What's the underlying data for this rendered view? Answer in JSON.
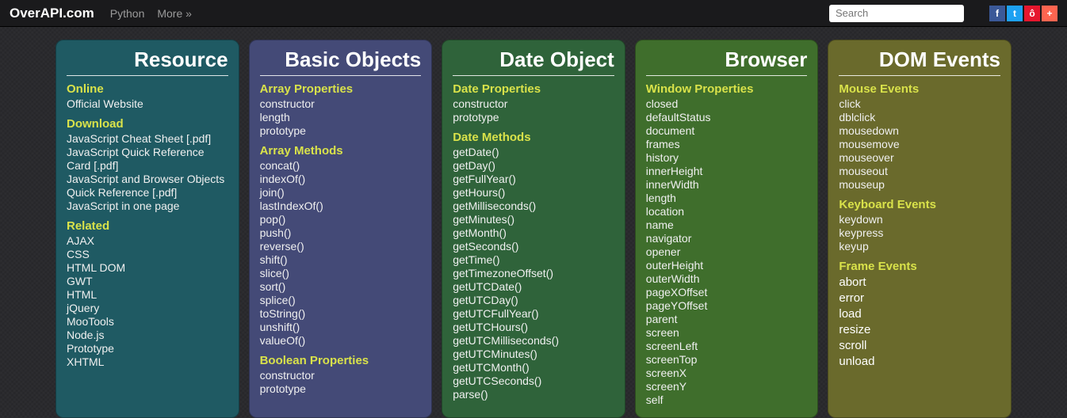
{
  "topbar": {
    "brand": "OverAPI.com",
    "links": [
      "Python",
      "More »"
    ],
    "search_placeholder": "Search",
    "social": [
      {
        "name": "facebook",
        "glyph": "f",
        "cls": "fb"
      },
      {
        "name": "twitter",
        "glyph": "t",
        "cls": "tw"
      },
      {
        "name": "weibo",
        "glyph": "ô",
        "cls": "wb"
      },
      {
        "name": "share",
        "glyph": "+",
        "cls": "pl"
      }
    ]
  },
  "columns": [
    {
      "title": "Resource",
      "cls": "c0",
      "groups": [
        {
          "heading": "Online",
          "items": [
            "Official Website"
          ]
        },
        {
          "heading": "Download",
          "items": [
            "JavaScript Cheat Sheet [.pdf]",
            "JavaScript Quick Reference Card [.pdf]",
            "JavaScript and Browser Objects Quick Reference [.pdf]",
            "JavaScript in one page"
          ]
        },
        {
          "heading": "Related",
          "items": [
            "AJAX",
            "CSS",
            "HTML DOM",
            "GWT",
            "HTML",
            "jQuery",
            "MooTools",
            "Node.js",
            "Prototype",
            "XHTML"
          ]
        }
      ]
    },
    {
      "title": "Basic Objects",
      "cls": "c1",
      "groups": [
        {
          "heading": "Array Properties",
          "items": [
            "constructor",
            "length",
            "prototype"
          ]
        },
        {
          "heading": "Array Methods",
          "items": [
            "concat()",
            "indexOf()",
            "join()",
            "lastIndexOf()",
            "pop()",
            "push()",
            "reverse()",
            "shift()",
            "slice()",
            "sort()",
            "splice()",
            "toString()",
            "unshift()",
            "valueOf()"
          ]
        },
        {
          "heading": "Boolean Properties",
          "items": [
            "constructor",
            "prototype"
          ]
        }
      ]
    },
    {
      "title": "Date Object",
      "cls": "c2",
      "groups": [
        {
          "heading": "Date Properties",
          "items": [
            "constructor",
            "prototype"
          ]
        },
        {
          "heading": "Date Methods",
          "items": [
            "getDate()",
            "getDay()",
            "getFullYear()",
            "getHours()",
            "getMilliseconds()",
            "getMinutes()",
            "getMonth()",
            "getSeconds()",
            "getTime()",
            "getTimezoneOffset()",
            "getUTCDate()",
            "getUTCDay()",
            "getUTCFullYear()",
            "getUTCHours()",
            "getUTCMilliseconds()",
            "getUTCMinutes()",
            "getUTCMonth()",
            "getUTCSeconds()",
            "parse()"
          ]
        }
      ]
    },
    {
      "title": "Browser",
      "cls": "c3",
      "groups": [
        {
          "heading": "Window Properties",
          "items": [
            "closed",
            "defaultStatus",
            "document",
            "frames",
            "history",
            "innerHeight",
            "innerWidth",
            "length",
            "location",
            "name",
            "navigator",
            "opener",
            "outerHeight",
            "outerWidth",
            "pageXOffset",
            "pageYOffset",
            "parent",
            "screen",
            "screenLeft",
            "screenTop",
            "screenX",
            "screenY",
            "self"
          ]
        }
      ]
    },
    {
      "title": "DOM Events",
      "cls": "c4",
      "groups": [
        {
          "heading": "Mouse Events",
          "items": [
            "click",
            "dblclick",
            "mousedown",
            "mousemove",
            "mouseover",
            "mouseout",
            "mouseup"
          ]
        },
        {
          "heading": "Keyboard Events",
          "items": [
            "keydown",
            "keypress",
            "keyup"
          ]
        },
        {
          "heading": "Frame Events",
          "alt": true,
          "items": [
            "abort",
            "error",
            "load",
            "resize",
            "scroll",
            "unload"
          ]
        }
      ]
    }
  ]
}
